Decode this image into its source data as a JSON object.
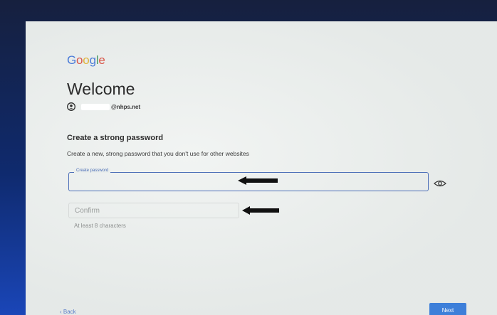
{
  "brand": {
    "logo_letters": [
      "G",
      "o",
      "o",
      "g",
      "l",
      "e"
    ]
  },
  "header": {
    "title": "Welcome",
    "account_email": "@nhps.net"
  },
  "form": {
    "section_title": "Create a strong password",
    "section_description": "Create a new, strong password that you don't use for other websites",
    "password_label": "Create password",
    "confirm_placeholder": "Confirm",
    "hint": "At least 8 characters"
  },
  "footer": {
    "back_label": "Back",
    "next_label": "Next"
  },
  "colors": {
    "accent": "#4d6fb8",
    "next_button": "#3d7fd9",
    "page_bg": "#eaeeec"
  }
}
